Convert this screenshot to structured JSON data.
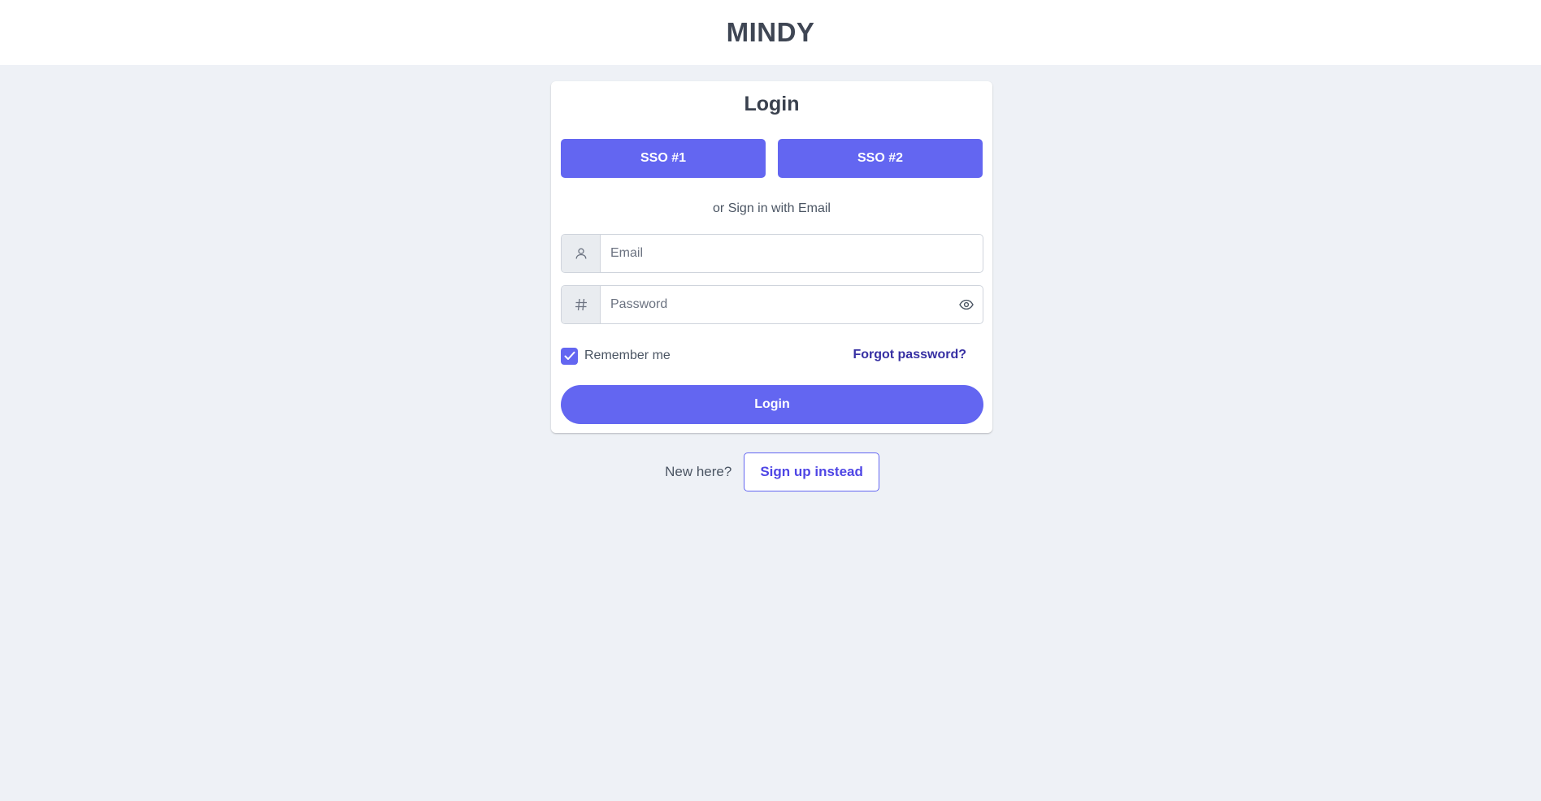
{
  "app": {
    "brand": "MINDY"
  },
  "login": {
    "title": "Login",
    "sso_buttons": [
      "SSO #1",
      "SSO #2"
    ],
    "divider_text": "or Sign in with Email",
    "email_placeholder": "Email",
    "email_icon": "user-icon",
    "password_placeholder": "Password",
    "password_icon": "hash-icon",
    "password_toggle_icon": "eye-icon",
    "remember_label": "Remember me",
    "remember_checked": true,
    "forgot_label": "Forgot password?",
    "submit_label": "Login"
  },
  "signup": {
    "prompt": "New here?",
    "button_label": "Sign up instead"
  },
  "colors": {
    "accent": "#6366f1",
    "link": "#3730a3",
    "background": "#eef1f6"
  }
}
